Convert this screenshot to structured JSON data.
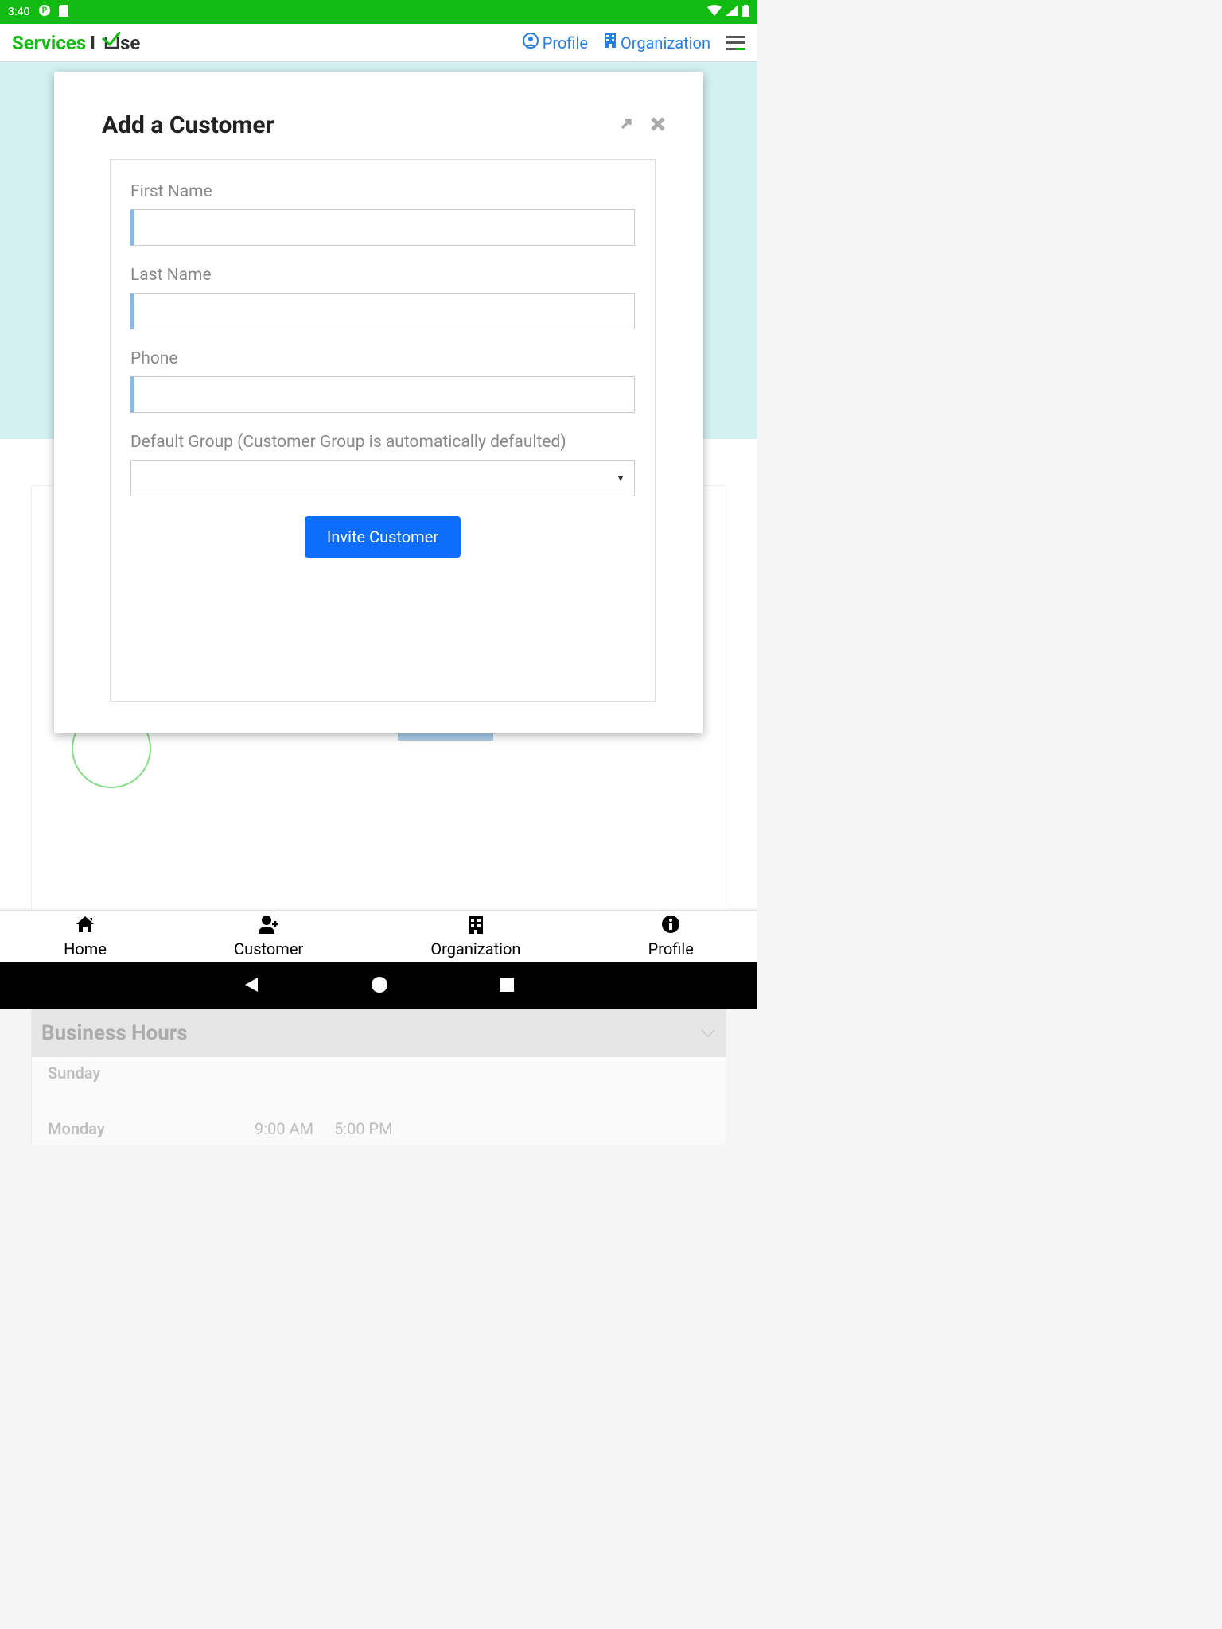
{
  "status": {
    "time": "3:40"
  },
  "header": {
    "logo_services": "Services",
    "logo_use": "se",
    "profile_label": "Profile",
    "organization_label": "Organization"
  },
  "modal": {
    "title": "Add a Customer",
    "first_name_label": "First Name",
    "first_name_value": "",
    "last_name_label": "Last Name",
    "last_name_value": "",
    "phone_label": "Phone",
    "phone_value": "",
    "default_group_label": "Default Group (Customer Group is automatically defaulted)",
    "default_group_value": "",
    "invite_button": "Invite Customer"
  },
  "business_hours": {
    "title": "Business Hours",
    "days": [
      {
        "name": "Sunday",
        "from": "",
        "to": ""
      },
      {
        "name": "Monday",
        "from": "9:00 AM",
        "to": "5:00 PM"
      }
    ]
  },
  "bottom_nav": {
    "home": "Home",
    "customer": "Customer",
    "organization": "Organization",
    "profile": "Profile"
  }
}
